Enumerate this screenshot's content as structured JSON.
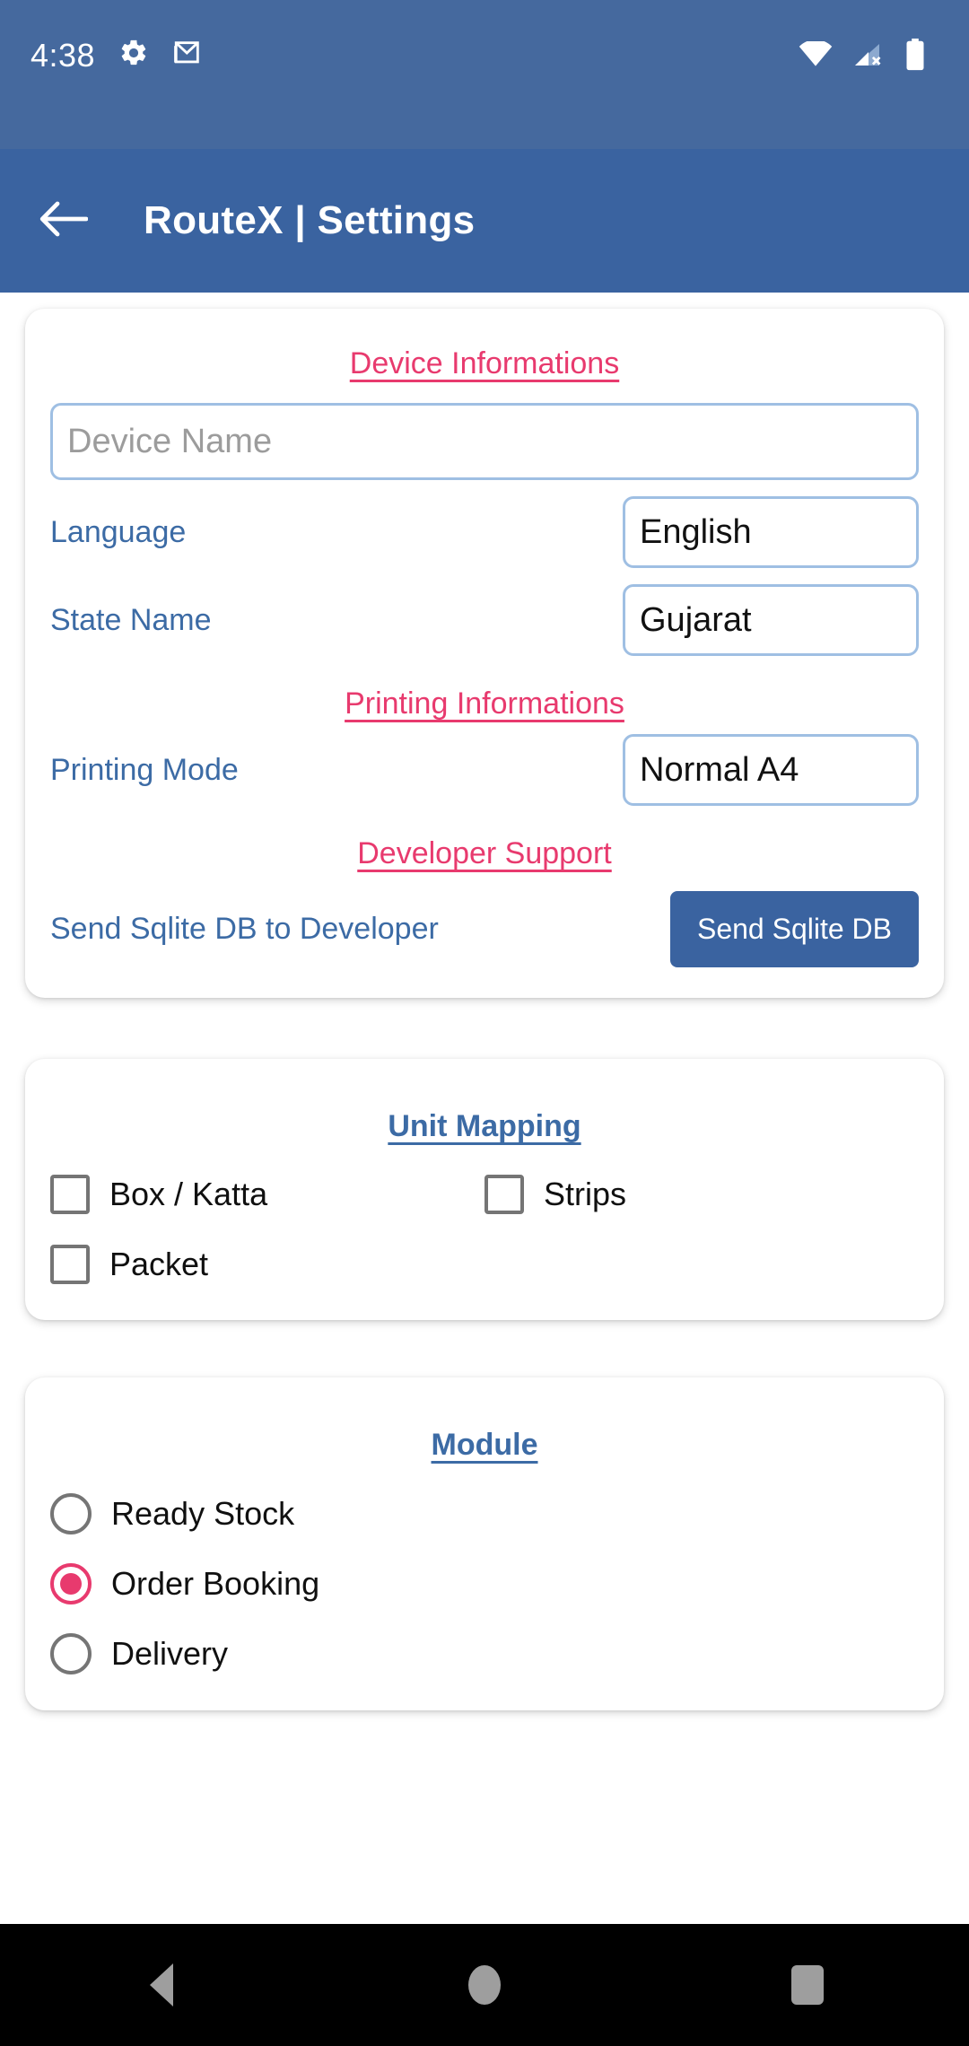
{
  "status_bar": {
    "time": "4:38",
    "left_icons": [
      "gear-icon",
      "gmail-icon"
    ],
    "right_icons": [
      "wifi-icon",
      "cellular-no-sim-icon",
      "battery-icon"
    ],
    "background_color": "#45699E"
  },
  "app_bar": {
    "back_icon": "back-arrow-icon",
    "title": "RouteX | Settings",
    "background_color": "#3A63A0"
  },
  "device_card": {
    "device_info_title": "Device Informations",
    "device_name_placeholder": "Device Name",
    "device_name_value": "",
    "language_label": "Language",
    "language_value": "English",
    "state_label": "State Name",
    "state_value": "Gujarat",
    "printing_title": "Printing Informations",
    "printing_mode_label": "Printing Mode",
    "printing_mode_value": "Normal A4",
    "developer_title": "Developer Support",
    "send_db_label": "Send Sqlite DB to Developer",
    "send_db_button": "Send Sqlite DB"
  },
  "unit_mapping": {
    "title": "Unit Mapping",
    "options": [
      {
        "label": "Box / Katta",
        "checked": false
      },
      {
        "label": "Strips",
        "checked": false
      },
      {
        "label": "Packet",
        "checked": false
      }
    ]
  },
  "module": {
    "title": "Module",
    "options": [
      {
        "label": "Ready Stock",
        "selected": false
      },
      {
        "label": "Order Booking",
        "selected": true
      },
      {
        "label": "Delivery",
        "selected": false
      }
    ]
  },
  "nav_bar": {
    "back": "nav-back-icon",
    "home": "nav-home-icon",
    "recents": "nav-recents-icon"
  },
  "colors": {
    "accent_pink": "#E83A6E",
    "label_blue": "#3C6BA5",
    "border_blue": "#9FBFE3",
    "app_bar_blue": "#3A63A0"
  }
}
